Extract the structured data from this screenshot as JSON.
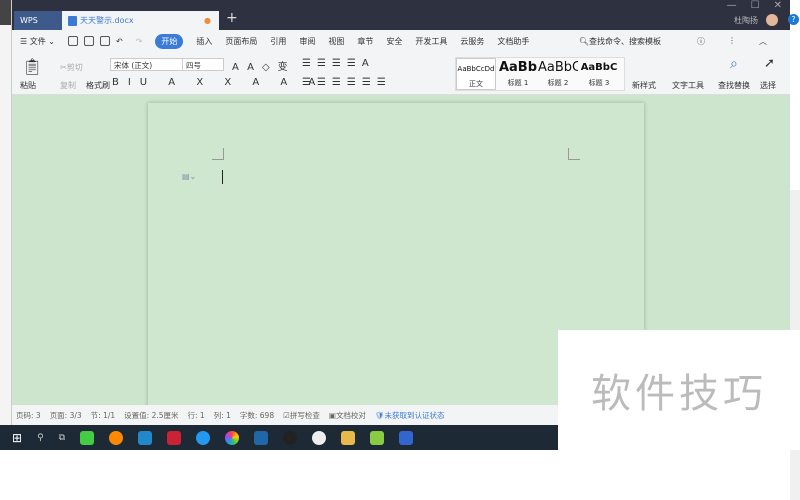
{
  "title_bar": {
    "app_tab": "WPS",
    "doc_tab": "天天警示.docx",
    "new_tab": "+",
    "user": "杜陶扬"
  },
  "menu": {
    "file": "文件",
    "tabs": [
      "开始",
      "插入",
      "页面布局",
      "引用",
      "审阅",
      "视图",
      "章节",
      "安全",
      "开发工具",
      "云服务",
      "文档助手"
    ],
    "search": "查找命令、搜索模板"
  },
  "ribbon": {
    "paste": "粘贴",
    "cut": "剪切",
    "copy": "复制",
    "format_painter": "格式刷",
    "font": "宋体 (正文)",
    "size": "四号",
    "styles": [
      {
        "preview": "AaBbCcDd",
        "label": "正文"
      },
      {
        "preview": "AaBb",
        "label": "标题 1"
      },
      {
        "preview": "AaBbC",
        "label": "标题 2"
      },
      {
        "preview": "AaBbC",
        "label": "标题 3"
      }
    ],
    "new_style": "新样式",
    "text_tools": "文字工具",
    "find_replace": "查找替换",
    "select": "选择"
  },
  "status": {
    "page": "页码: 3",
    "pages": "页面: 3/3",
    "section": "节: 1/1",
    "setting": "设置值: 2.5厘米",
    "row": "行: 1",
    "col": "列: 1",
    "words": "字数: 698",
    "spell": "拼写检查",
    "proof": "文档校对",
    "cert": "未获取到认证状态"
  },
  "watermark": "软件技巧"
}
